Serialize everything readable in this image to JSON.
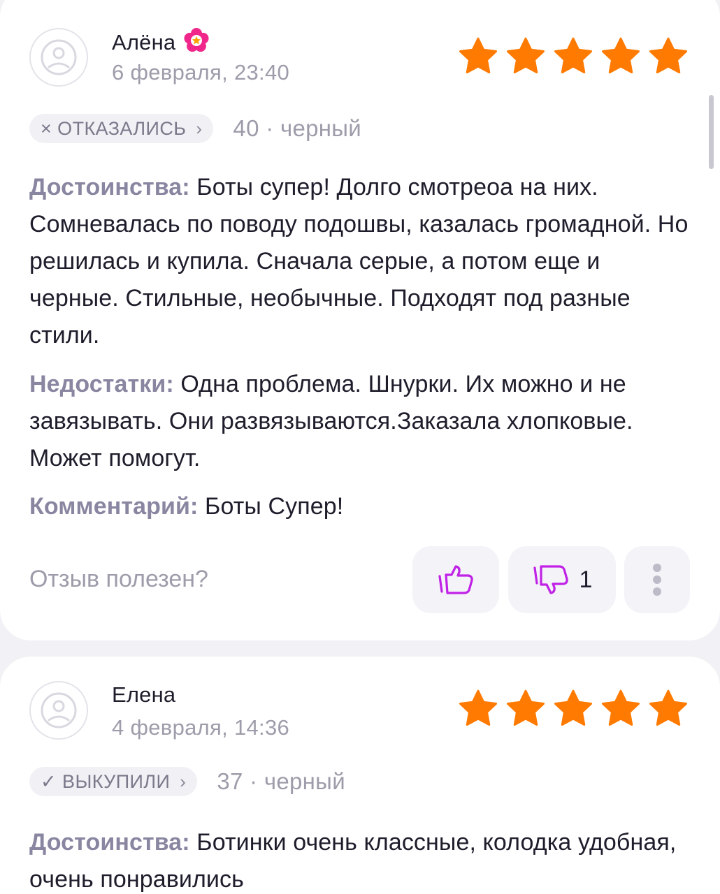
{
  "reviews": [
    {
      "author": "Алёна",
      "date": "6 февраля, 23:40",
      "rating": 5,
      "status_icon": "×",
      "status": "ОТКАЗАЛИСЬ",
      "variant": "40 · черный",
      "pros_label": "Достоинства:",
      "pros": "Боты супер! Долго смотреоа на них. Сомневалась по поводу подошвы, казалась громадной. Но решилась и купила. Сначала серые, а потом еще и черные. Стильные, необычные. Подходят под разные стили.",
      "cons_label": "Недостатки:",
      "cons": "Одна проблема. Шнурки. Их можно и не завязывать. Они развязываются.Заказала хлопковые. Может помогут.",
      "comment_label": "Комментарий:",
      "comment": "Боты Супер!",
      "helpful_question": "Отзыв полезен?",
      "dislikes": "1"
    },
    {
      "author": "Елена",
      "date": "4 февраля, 14:36",
      "rating": 5,
      "status_icon": "✓",
      "status": "ВЫКУПИЛИ",
      "variant": "37 · черный",
      "pros_label": "Достоинства:",
      "pros": "Ботинки очень классные, колодка удобная, очень понравились"
    }
  ],
  "colors": {
    "star": "#ff7a00",
    "vote_icon": "#c022e6",
    "badge": "#f0268a",
    "label": "#8886a0",
    "muted": "#9e9caa"
  },
  "icons": {
    "avatar": "sad-face-icon",
    "badge": "flower-badge-icon",
    "star": "star-icon",
    "like": "thumbs-up-icon",
    "dislike": "thumbs-down-icon",
    "more": "more-vertical-icon"
  }
}
